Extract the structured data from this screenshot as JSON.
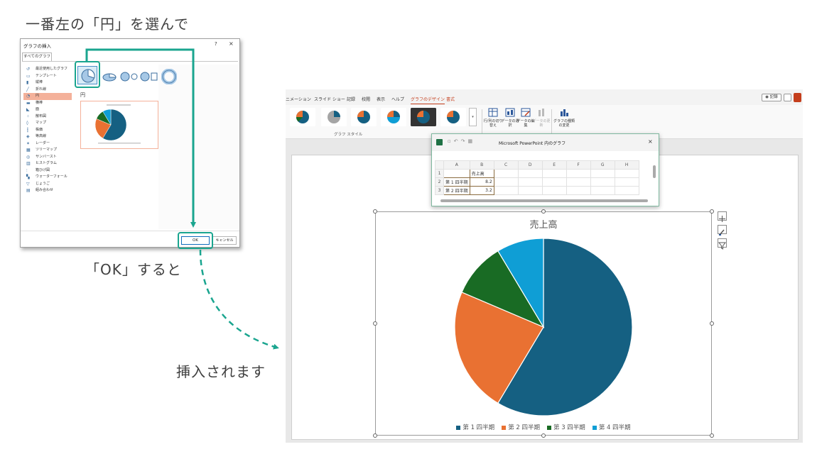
{
  "captions": {
    "top": "一番左の「円」を選んで",
    "ok": "「OK」すると",
    "inserted": "挿入されます"
  },
  "dialog": {
    "title": "グラフの挿入",
    "help": "?",
    "close": "×",
    "tab": "すべてのグラフ",
    "categories": [
      "最近使用したグラフ",
      "テンプレート",
      "縦棒",
      "折れ線",
      "円",
      "横棒",
      "面",
      "散布図",
      "マップ",
      "株価",
      "等高線",
      "レーダー",
      "ツリーマップ",
      "サンバースト",
      "ヒストグラム",
      "箱ひげ図",
      "ウォーターフォール",
      "じょうご",
      "組み合わせ"
    ],
    "selected_category": "円",
    "pie_heading": "円",
    "ok_label": "OK",
    "cancel_label": "キャンセル"
  },
  "ribbon": {
    "tabs": [
      "ニメーション",
      "スライド ショー",
      "記録",
      "校閲",
      "表示",
      "ヘルプ",
      "グラフのデザイン",
      "書式"
    ],
    "active_tab": "グラフのデザイン",
    "record": "記録",
    "styles_group": "グラフ スタイル",
    "buttons": [
      "行/列の切り替え",
      "データの選択",
      "データの編集",
      "データの更新",
      "グラフの種類の変更"
    ]
  },
  "sheet": {
    "title": "Microsoft PowerPoint 内のグラフ",
    "close": "×",
    "columns": [
      "A",
      "B",
      "C",
      "D",
      "E",
      "F",
      "G",
      "H"
    ],
    "rows": [
      {
        "num": "1",
        "a": "",
        "b": "売上高"
      },
      {
        "num": "2",
        "a": "第 1 四半期",
        "b": "8.2"
      },
      {
        "num": "3",
        "a": "第 2 四半期",
        "b": "3.2"
      }
    ]
  },
  "chart_data": {
    "type": "pie",
    "title": "売上高",
    "categories": [
      "第 1 四半期",
      "第 2 四半期",
      "第 3 四半期",
      "第 4 四半期"
    ],
    "values": [
      8.2,
      3.2,
      1.4,
      1.2
    ],
    "colors": [
      "#156082",
      "#e97132",
      "#196b24",
      "#0f9ed5"
    ],
    "legend_position": "bottom"
  }
}
